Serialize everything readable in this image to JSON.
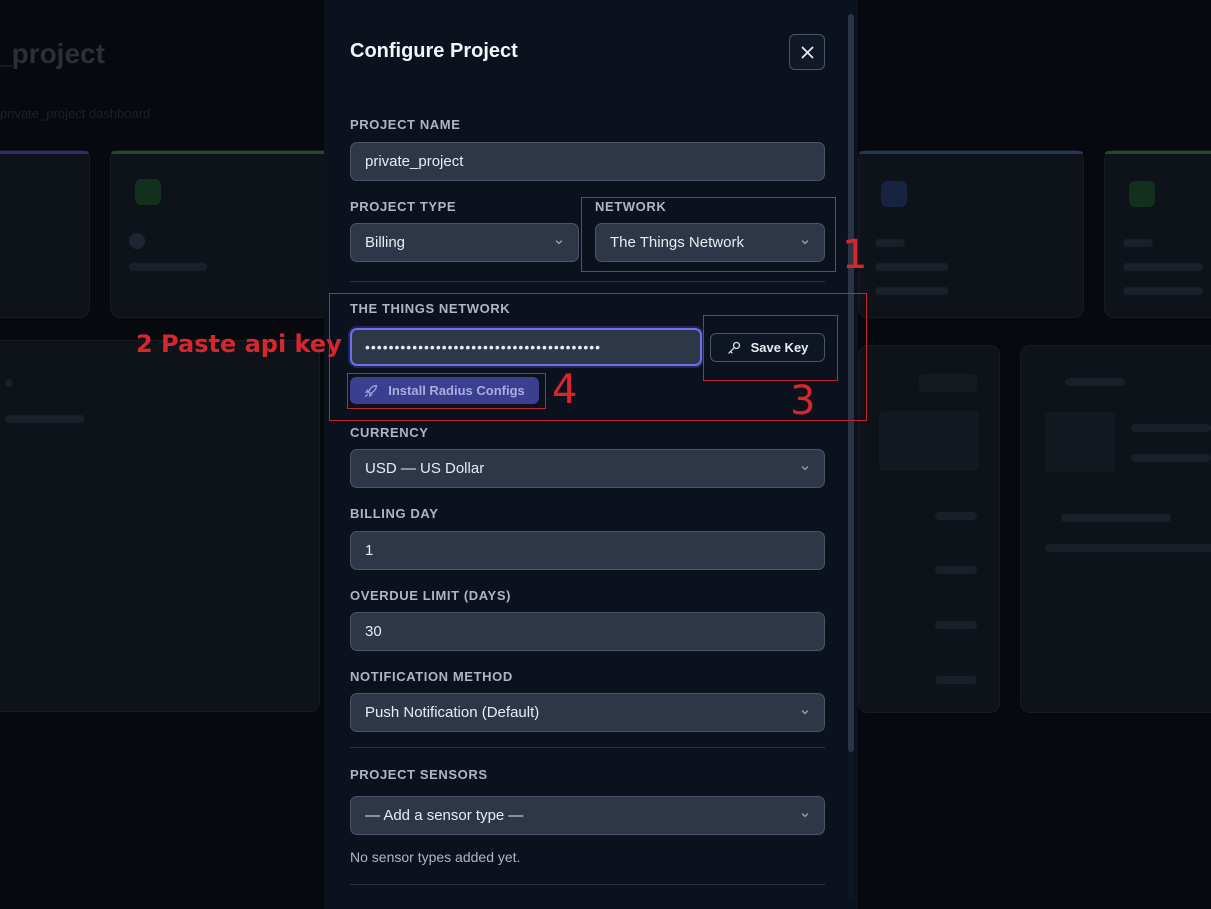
{
  "background": {
    "title": "_project",
    "subtitle": "private_project dashboard",
    "card_accent_colors": [
      "#3b3f8f",
      "#1f5130",
      "#1f5130",
      "#2b3d6b",
      "#1f5130"
    ]
  },
  "modal": {
    "title": "Configure Project",
    "close_icon": "close-icon",
    "project_name": {
      "label": "PROJECT NAME",
      "value": "private_project"
    },
    "project_type": {
      "label": "PROJECT TYPE",
      "value": "Billing"
    },
    "network": {
      "label": "NETWORK",
      "value": "The Things Network"
    },
    "ttn": {
      "label": "THE THINGS NETWORK",
      "api_key_value": "••••••••••••••••••••••••••••••••••••••••",
      "save_key_label": "Save Key",
      "save_key_icon": "key-icon",
      "install_label": "Install Radius Configs",
      "install_icon": "rocket-icon"
    },
    "currency": {
      "label": "CURRENCY",
      "value": "USD — US Dollar"
    },
    "billing_day": {
      "label": "BILLING DAY",
      "value": "1"
    },
    "overdue_limit": {
      "label": "OVERDUE LIMIT (DAYS)",
      "value": "30"
    },
    "notification_method": {
      "label": "NOTIFICATION METHOD",
      "value": "Push Notification (Default)"
    },
    "sensors": {
      "label": "PROJECT SENSORS",
      "placeholder": "— Add a sensor type —",
      "empty_text": "No sensor types added yet."
    }
  },
  "annotations": {
    "step1": "1",
    "step2": "2 Paste api key",
    "step3": "3",
    "step4": "4",
    "color": "#d8262d"
  }
}
